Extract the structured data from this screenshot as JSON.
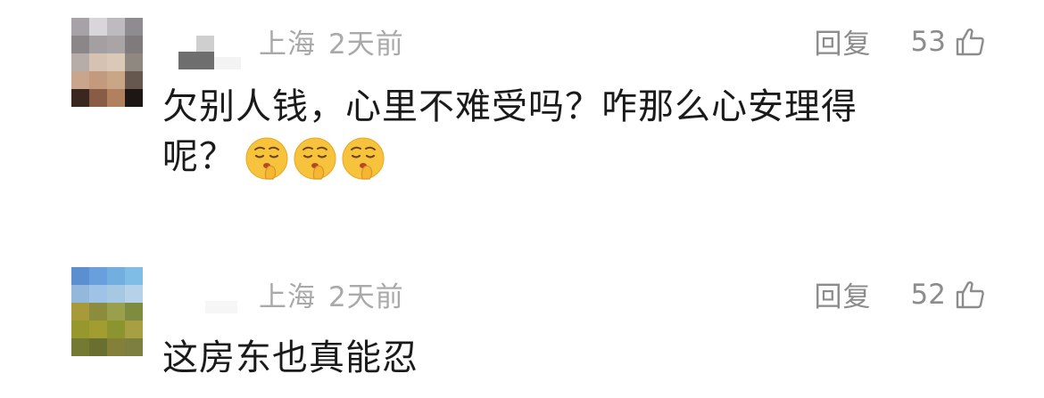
{
  "comments": [
    {
      "location": "上海",
      "time": "2天前",
      "reply_label": "回复",
      "likes": "53",
      "text_line1": "欠别人钱，心里不难受吗？咋那么心安理得",
      "text_line2": "呢？",
      "emojis": [
        "shushing-face-icon",
        "shushing-face-icon",
        "shushing-face-icon"
      ]
    },
    {
      "location": "上海",
      "time": "2天前",
      "reply_label": "回复",
      "likes": "52",
      "text_line1": "这房东也真能忍"
    }
  ],
  "colors": {
    "meta_text": "#a9a9a9",
    "action_text": "#8c8c8c",
    "body_text": "#1a1a1a",
    "emoji_face": "#f7c33c"
  }
}
